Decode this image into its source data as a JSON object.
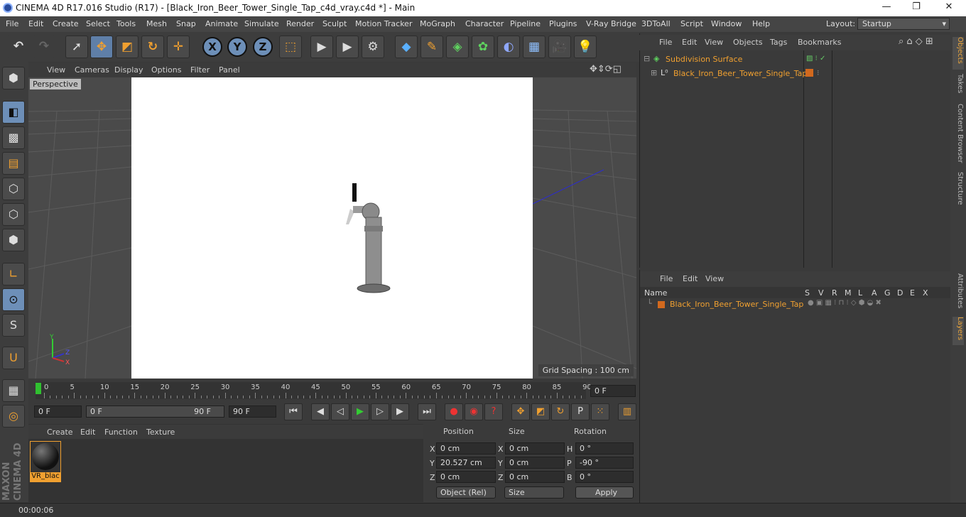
{
  "window": {
    "title": "CINEMA 4D R17.016 Studio (R17) - [Black_Iron_Beer_Tower_Single_Tap_c4d_vray.c4d *] - Main",
    "minimize": "—",
    "maximize": "❐",
    "close": "✕"
  },
  "menubar": {
    "items": [
      "File",
      "Edit",
      "Create",
      "Select",
      "Tools",
      "Mesh",
      "Snap",
      "Animate",
      "Simulate",
      "Render",
      "Sculpt",
      "Motion Tracker",
      "MoGraph",
      "Character",
      "Pipeline",
      "Plugins",
      "V-Ray Bridge",
      "3DToAll",
      "Script",
      "Window",
      "Help"
    ],
    "layout_label": "Layout:",
    "layout_value": "Startup"
  },
  "viewport": {
    "menu": [
      "View",
      "Cameras",
      "Display",
      "Options",
      "Filter",
      "Panel"
    ],
    "label": "Perspective",
    "grid_spacing": "Grid Spacing : 100 cm"
  },
  "timeline": {
    "ticks": [
      "0",
      "5",
      "10",
      "15",
      "20",
      "25",
      "30",
      "35",
      "40",
      "45",
      "50",
      "55",
      "60",
      "65",
      "70",
      "75",
      "80",
      "85",
      "90"
    ],
    "current_frame": "0 F",
    "start": "0 F",
    "range_start": "0 F",
    "range_end": "90 F",
    "end": "90 F"
  },
  "materials": {
    "menu": [
      "Create",
      "Edit",
      "Function",
      "Texture"
    ],
    "items": [
      {
        "name": "VR_blac"
      }
    ]
  },
  "coordinates": {
    "headers": [
      "Position",
      "Size",
      "Rotation"
    ],
    "rows": [
      {
        "axis": "X",
        "pos": "0 cm",
        "size_axis": "X",
        "size": "0 cm",
        "rot_axis": "H",
        "rot": "0 °"
      },
      {
        "axis": "Y",
        "pos": "20.527 cm",
        "size_axis": "Y",
        "size": "0 cm",
        "rot_axis": "P",
        "rot": "-90 °"
      },
      {
        "axis": "Z",
        "pos": "0 cm",
        "size_axis": "Z",
        "size": "0 cm",
        "rot_axis": "B",
        "rot": "0 °"
      }
    ],
    "mode": "Object (Rel)",
    "size_mode": "Size",
    "apply": "Apply"
  },
  "objects": {
    "menu": [
      "File",
      "Edit",
      "View",
      "Objects",
      "Tags",
      "Bookmarks"
    ],
    "tree": [
      {
        "name": "Subdivision Surface"
      },
      {
        "name": "Black_Iron_Beer_Tower_Single_Tap"
      }
    ]
  },
  "layers": {
    "menu": [
      "File",
      "Edit",
      "View"
    ],
    "header_name": "Name",
    "columns": [
      "S",
      "V",
      "R",
      "M",
      "L",
      "A",
      "G",
      "D",
      "E",
      "X"
    ],
    "rows": [
      {
        "name": "Black_Iron_Beer_Tower_Single_Tap",
        "color": "#d2691e"
      }
    ]
  },
  "right_tabs": [
    "Objects",
    "Takes",
    "Content Browser",
    "Structure",
    "Attributes",
    "Layers"
  ],
  "status": {
    "time": "00:00:06"
  },
  "brand": {
    "line1": "MAXON",
    "line2": "CINEMA 4D"
  }
}
